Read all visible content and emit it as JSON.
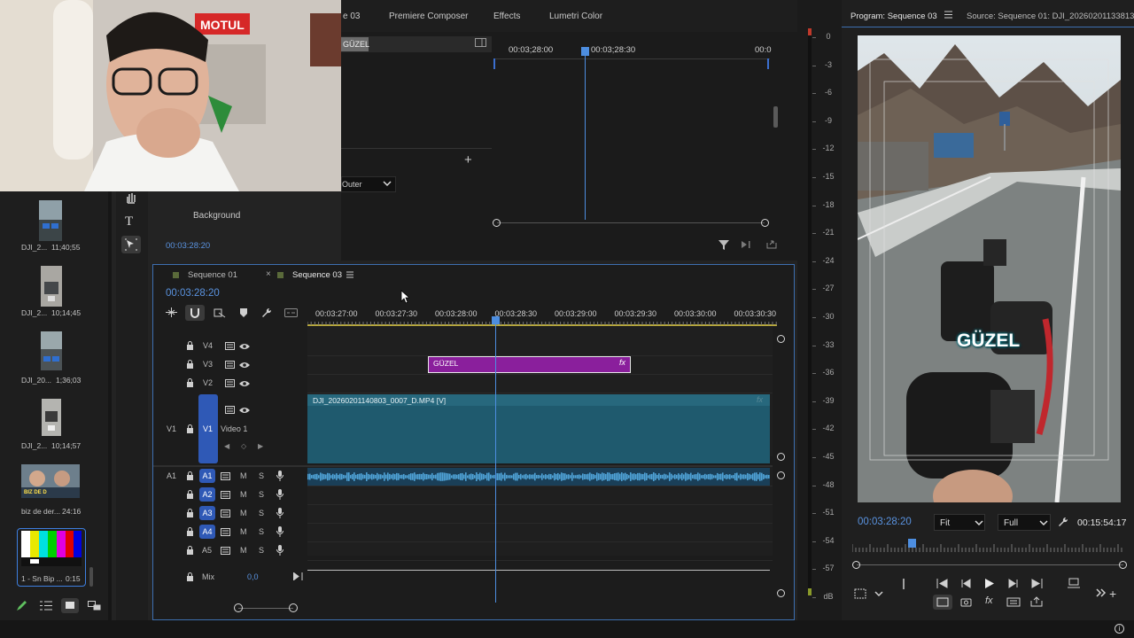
{
  "workspace_tabs": [
    "e 03",
    "Premiere Composer",
    "Effects",
    "Lumetri Color"
  ],
  "effect_controls": {
    "clip_tag": "GÜZEL",
    "ruler": [
      "00:03;28:00",
      "00:03;28:30",
      "00:0"
    ],
    "stroke_position": "Outer",
    "background_label": "Background",
    "timecode": "00:03:28:20"
  },
  "meters": {
    "db_scale": [
      "0",
      "-3",
      "-6",
      "-9",
      "-12",
      "-15",
      "-18",
      "-21",
      "-24",
      "-27",
      "-30",
      "-33",
      "-36",
      "-39",
      "-42",
      "-45",
      "-48",
      "-51",
      "-54",
      "-57",
      "dB"
    ]
  },
  "program": {
    "title": "Program: Sequence 03",
    "source_title": "Source: Sequence 01: DJI_20260201133813",
    "overlay_text": "GÜZEL",
    "timecode": "00:03:28:20",
    "fit": "Fit",
    "resolution": "Full",
    "duration": "00:15:54:17",
    "playhead_fraction": 0.22
  },
  "bin": {
    "items": [
      {
        "name": "DJI_2...",
        "duration": "11;40;55"
      },
      {
        "name": "DJI_2...",
        "duration": "10;14;45"
      },
      {
        "name": "DJI_20...",
        "duration": "1;36;03"
      },
      {
        "name": "DJI_2...",
        "duration": "10;14;57"
      },
      {
        "name": "biz de der...",
        "duration": "24:16",
        "thumb_text": "BIZ DE D"
      },
      {
        "name": "1 - Sn Bip ...",
        "duration": "0:15"
      }
    ]
  },
  "timeline": {
    "tabs": [
      "Sequence 01",
      "Sequence 03"
    ],
    "timecode": "00:03:28:20",
    "ruler": [
      "00:03:27:00",
      "00:03:27:30",
      "00:03:28:00",
      "00:03:28:30",
      "00:03:29:00",
      "00:03:29:30",
      "00:03:30:00",
      "00:03:30:30"
    ],
    "video_tracks": [
      {
        "label": "V4"
      },
      {
        "label": "V3"
      },
      {
        "label": "V2"
      },
      {
        "label": "V1",
        "name": "Video 1",
        "source": "V1"
      }
    ],
    "audio_tracks": [
      {
        "source": "A1",
        "label": "A1"
      },
      {
        "label": "A2"
      },
      {
        "label": "A3"
      },
      {
        "label": "A4"
      },
      {
        "label": "A5"
      }
    ],
    "m_label": "M",
    "s_label": "S",
    "title_clip": "GÜZEL",
    "video_clip": "DJI_20260201140803_0007_D.MP4 [V]",
    "mix_label": "Mix",
    "mix_value": "0,0",
    "colors": {
      "title_clip": "#8a1f9c",
      "video_clip": "#1f5a6e",
      "audio_clip": "#4fa3d8",
      "playhead": "#4d8ee0"
    }
  }
}
